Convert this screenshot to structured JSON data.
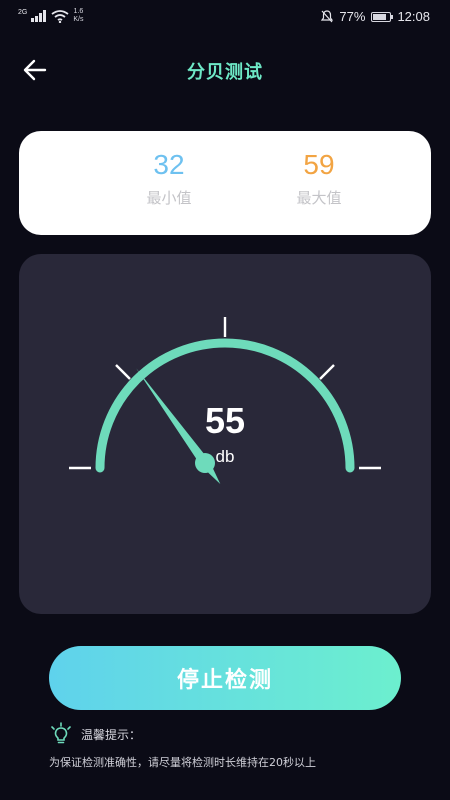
{
  "status_bar": {
    "network_type": "2G",
    "network_speed_value": "1.6",
    "network_speed_unit": "K/s",
    "battery_percent": "77%",
    "battery_level": 0.77,
    "time": "12:08"
  },
  "header": {
    "title": "分贝测试",
    "back_icon": "arrow-left-icon"
  },
  "stats": {
    "min_value": "32",
    "min_label": "最小值",
    "max_value": "59",
    "max_label": "最大值",
    "min_color": "#6ec1f0",
    "max_color": "#f2a443"
  },
  "gauge": {
    "value": "55",
    "unit": "db",
    "needle_level": 0.3,
    "arc_color": "#6edbbb"
  },
  "actions": {
    "stop_label": "停止检测"
  },
  "tip": {
    "icon": "lightbulb-icon",
    "title": "温馨提示：",
    "text": "为保证检测准确性，请尽量将检测时长维持在20秒以上"
  }
}
